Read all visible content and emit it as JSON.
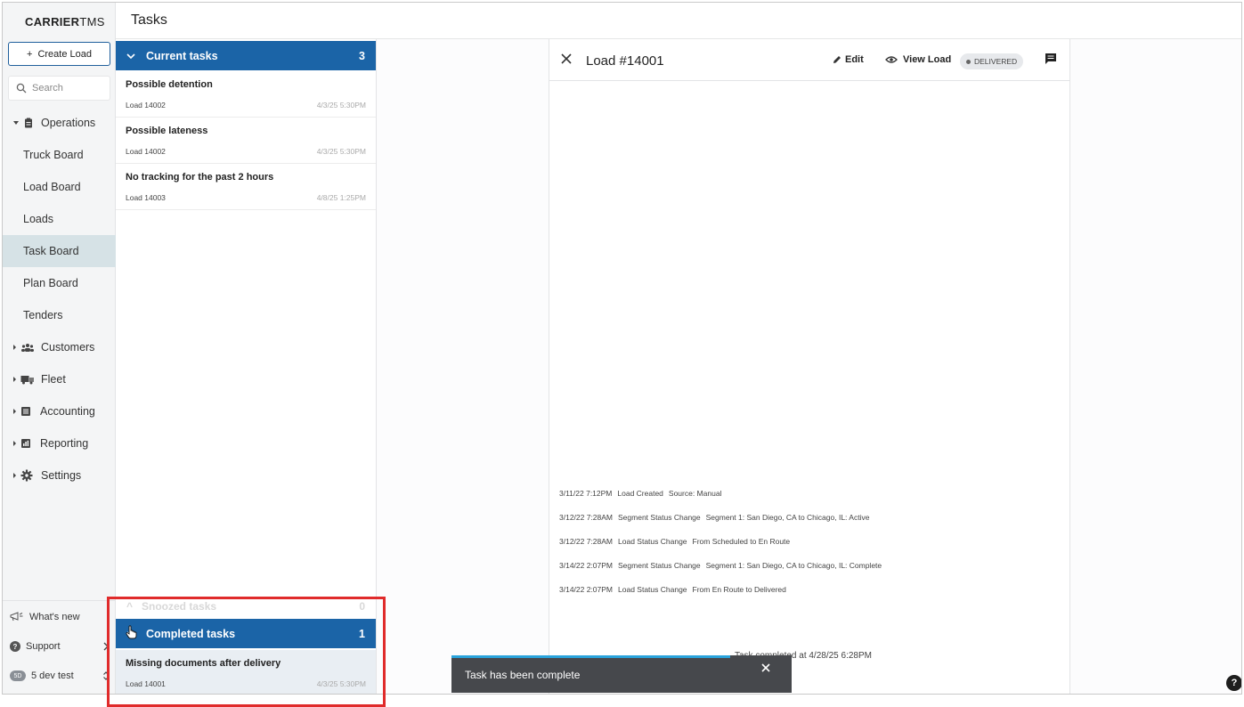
{
  "app": {
    "logo_bold": "CARRIER",
    "logo_light": "TMS",
    "page_title": "Tasks"
  },
  "sidebar": {
    "create_label": "Create Load",
    "search_placeholder": "Search",
    "operations_label": "Operations",
    "items": [
      {
        "label": "Truck Board"
      },
      {
        "label": "Load Board"
      },
      {
        "label": "Loads"
      },
      {
        "label": "Task Board",
        "active": true
      },
      {
        "label": "Plan Board"
      },
      {
        "label": "Tenders"
      }
    ],
    "groups": [
      {
        "label": "Customers",
        "icon": "customers-icon"
      },
      {
        "label": "Fleet",
        "icon": "truck-icon"
      },
      {
        "label": "Accounting",
        "icon": "ledger-icon"
      },
      {
        "label": "Reporting",
        "icon": "chart-icon"
      },
      {
        "label": "Settings",
        "icon": "gear-icon"
      }
    ],
    "whats_new": "What's new",
    "support": "Support",
    "user": "5 dev test",
    "user_initials": "5D"
  },
  "tasks": {
    "current_label": "Current tasks",
    "current_count": "3",
    "current": [
      {
        "title": "Possible detention",
        "load": "Load 14002",
        "date": "4/3/25 5:30PM"
      },
      {
        "title": "Possible lateness",
        "load": "Load 14002",
        "date": "4/3/25 5:30PM"
      },
      {
        "title": "No tracking for the past 2 hours",
        "load": "Load 14003",
        "date": "4/8/25 1:25PM"
      }
    ],
    "snoozed_label": "Snoozed tasks",
    "snoozed_count": "0",
    "completed_label": "Completed tasks",
    "completed_count": "1",
    "completed": [
      {
        "title": "Missing documents after delivery",
        "load": "Load 14001",
        "date": "4/3/25 5:30PM"
      }
    ]
  },
  "detail": {
    "title": "Load #14001",
    "edit_label": "Edit",
    "view_label": "View Load",
    "status": "DELIVERED",
    "history": [
      {
        "time": "3/11/22 7:12PM",
        "event": "Load Created",
        "detail": "Source: Manual"
      },
      {
        "time": "3/12/22 7:28AM",
        "event": "Segment Status Change",
        "detail": "Segment 1: San Diego, CA to Chicago, IL: Active"
      },
      {
        "time": "3/12/22 7:28AM",
        "event": "Load Status Change",
        "detail": "From Scheduled to En Route"
      },
      {
        "time": "3/14/22 2:07PM",
        "event": "Segment Status Change",
        "detail": "Segment 1: San Diego, CA to Chicago, IL: Complete"
      },
      {
        "time": "3/14/22 2:07PM",
        "event": "Load Status Change",
        "detail": "From En Route to Delivered"
      }
    ],
    "completed_note": "Task completed at 4/28/25 6:28PM"
  },
  "toast": {
    "message": "Task has been complete",
    "progress": 0.82
  },
  "help_label": "?",
  "colors": {
    "primary": "#1b64a7",
    "highlight": "#e02b2b",
    "toast_bg": "#46484c",
    "toast_progress": "#29a3dc"
  }
}
